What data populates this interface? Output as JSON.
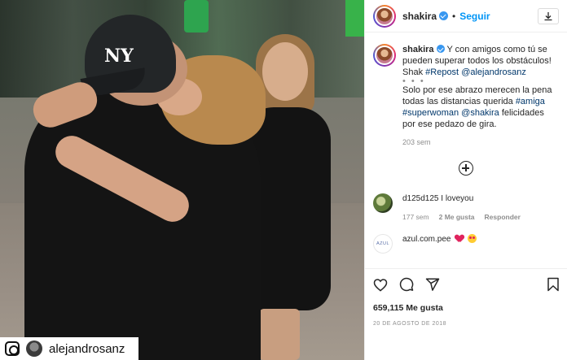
{
  "photo": {
    "cap_logo": "NY",
    "tag": {
      "icon": "instagram-icon",
      "username": "alejandrosanz"
    }
  },
  "post_header": {
    "username": "shakira",
    "separator": "•",
    "follow_label": "Seguir",
    "download_icon": "download-icon"
  },
  "caption": {
    "username": "shakira",
    "text_1": "Y con amigos como tú se pueden superar todos los obstáculos! Shak",
    "repost": "#Repost",
    "mention": "@alejandrosanz",
    "dots": "• • •",
    "text_2": "Solo por ese abrazo merecen la pena todas las distancias querida",
    "tag_amiga": "#amiga",
    "tag_superwoman": "#superwoman",
    "tag_shakira": "@shakira",
    "text_3": "felicidades por ese pedazo de gira.",
    "time": "203 sem"
  },
  "comments": [
    {
      "username": "d125d125",
      "text": "I loveyou",
      "time": "177 sem",
      "likes": "2 Me gusta",
      "reply": "Responder"
    },
    {
      "username": "azul.com.pee",
      "avatar_text": "AZUL"
    }
  ],
  "actions": {
    "like_count": "659,115 Me gusta",
    "date": "20 DE AGOSTO DE 2018"
  },
  "colors": {
    "link": "#00376b",
    "follow": "#0095f6",
    "verified": "#3897f0",
    "muted": "#8e8e8e"
  }
}
